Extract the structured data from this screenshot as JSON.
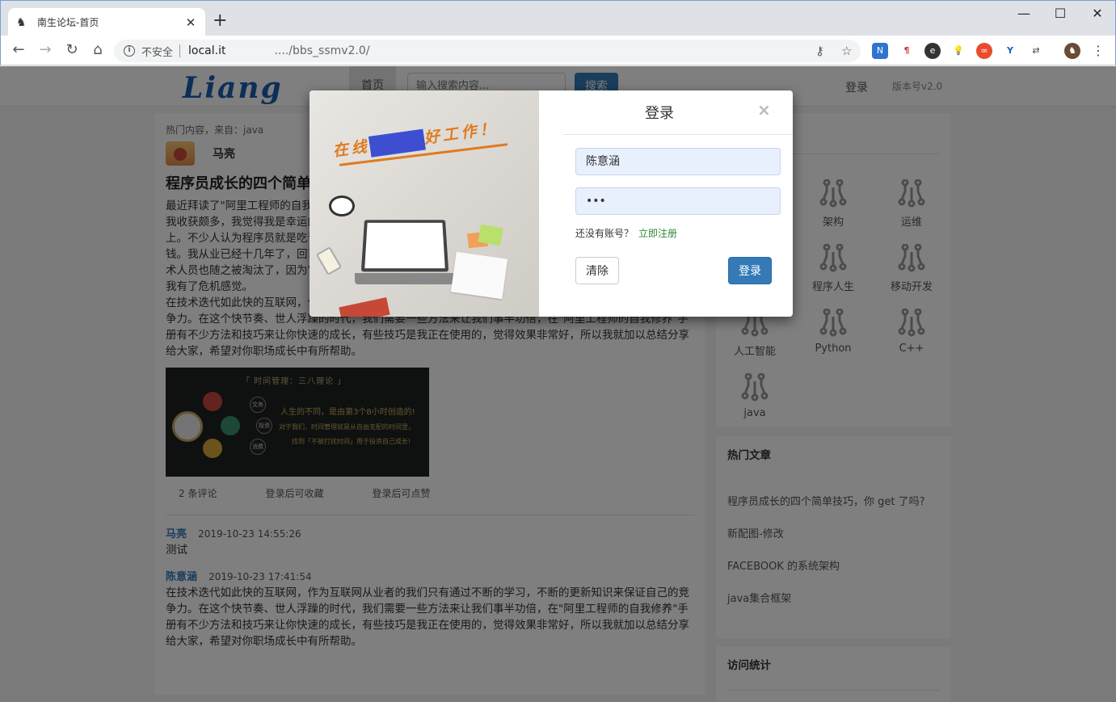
{
  "browser": {
    "tab_title": "南生论坛-首页",
    "url_insecure_label": "不安全",
    "url_host": "local.it",
    "url_path": "..../bbs_ssmv2.0/"
  },
  "site": {
    "logo_text": "Liang",
    "nav_home": "首页",
    "search_placeholder": "输入搜索内容...",
    "search_button": "搜索",
    "nav_login": "登录",
    "version": "版本号v2.0"
  },
  "post": {
    "hot_source": "热门内容，来自：java",
    "author": "马亮",
    "title": "程序员成长的四个简单",
    "body": "最近拜读了\"阿里工程师的自我修养\"手册，在过去的这些年里，我一直在思考一个问题：如何度过中年危机，我收获颇多，我觉得我是幸运的，我在技术的道路上一直在坚持，我认为是幸运的，我走在了一条正确的道路上。不少人认为程序员就是吃青春饭的，年龄越大越不吃香，越来越吃香，但是我们不一样，我们会越来越值钱。我从业已经十几年了，回首往事，我发现在我工作的这短短几年时间就有很多技术已经被淘汰了，很多技术人员也随之被淘汰了，因为它们已经没有市场了，不是技术人员的能力不行，而是技术不被人需要了，这让我有了危机感觉。",
    "body2": "在技术迭代如此快的互联网，作为互联网从业者的我们只有通过不断的学习，不断的更新知识来保证自己的竞争力。在这个快节奏、世人浮躁的时代，我们需要一些方法来让我们事半功倍，在\"阿里工程师的自我修养\"手册有不少方法和技巧来让你快速的成长，有些技巧是我正在使用的，觉得效果非常好，所以我就加以总结分享给大家，希望对你职场成长中有所帮助。",
    "image_title": "「 时间管理：三八理论 」",
    "image_quote1": "人生的不同，是由第3个8小时创造的!",
    "image_quote2": "对于我们，时间管理就是从自由支配的时间里，",
    "image_quote3": "找到「不被打扰时间」用于投资自己成长!",
    "image_nodes": [
      "文务",
      "投资",
      "消费"
    ],
    "comments_count": "2 条评论",
    "favorite_hint": "登录后可收藏",
    "like_hint": "登录后可点赞"
  },
  "comments": [
    {
      "user": "马亮",
      "time": "2019-10-23 14:55:26",
      "text": "测试"
    },
    {
      "user": "陈意涵",
      "time": "2019-10-23 17:41:54",
      "text": "在技术迭代如此快的互联网，作为互联网从业者的我们只有通过不断的学习，不断的更新知识来保证自己的竞争力。在这个快节奏、世人浮躁的时代，我们需要一些方法来让我们事半功倍，在\"阿里工程师的自我修养\"手册有不少方法和技巧来让你快速的成长，有些技巧是我正在使用的，觉得效果非常好，所以我就加以总结分享给大家，希望对你职场成长中有所帮助。"
    }
  ],
  "categories": [
    "架构",
    "运维",
    "程序人生",
    "移动开发",
    "人工智能",
    "Python",
    "C++",
    "java"
  ],
  "hot_articles": {
    "title": "热门文章",
    "items": [
      "程序员成长的四个简单技巧，你 get 了吗?",
      "新配图-修改",
      "FACEBOOK 的系统架构",
      "java集合框架"
    ]
  },
  "stats": {
    "title": "访问统计"
  },
  "modal": {
    "title": "登录",
    "close": "×",
    "username_value": "陈意涵",
    "password_value": "•••",
    "no_account": "还没有账号？",
    "register_link": "立即注册",
    "clear_button": "清除",
    "login_button": "登录",
    "art_slogan_left": "在线",
    "art_slogan_right": "好工作！"
  },
  "colors": {
    "primary": "#337ab7",
    "link_green": "#2e8b3a",
    "orange": "#e07a1f"
  }
}
